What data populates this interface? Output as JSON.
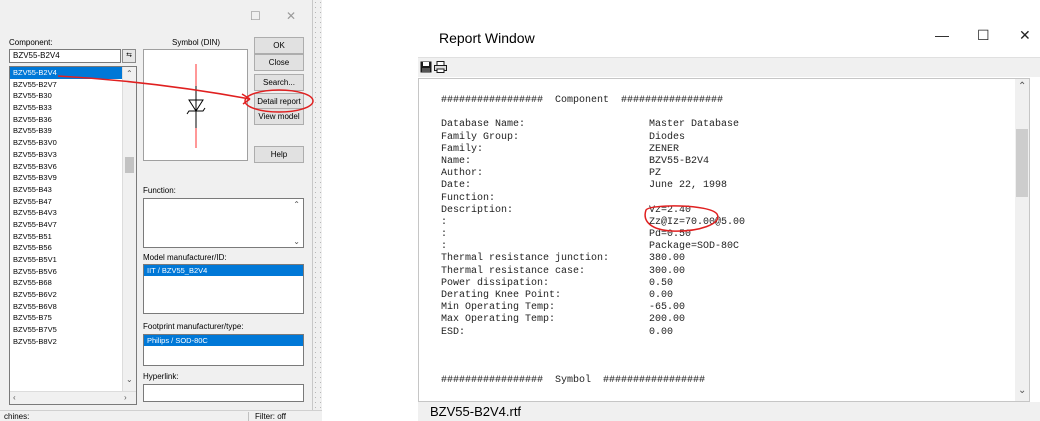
{
  "component_window": {
    "labels": {
      "component": "Component:",
      "symbol": "Symbol (DIN)",
      "function": "Function:",
      "model": "Model manufacturer/ID:",
      "footprint": "Footprint manufacturer/type:",
      "hyperlink": "Hyperlink:"
    },
    "search_value": "BZV55-B2V4",
    "filter_icon": "filter-icon",
    "components": [
      "BZV55-B2V4",
      "BZV55-B2V7",
      "BZV55-B30",
      "BZV55-B33",
      "BZV55-B36",
      "BZV55-B39",
      "BZV55-B3V0",
      "BZV55-B3V3",
      "BZV55-B3V6",
      "BZV55-B3V9",
      "BZV55-B43",
      "BZV55-B47",
      "BZV55-B4V3",
      "BZV55-B4V7",
      "BZV55-B51",
      "BZV55-B56",
      "BZV55-B5V1",
      "BZV55-B5V6",
      "BZV55-B68",
      "BZV55-B6V2",
      "BZV55-B6V8",
      "BZV55-B75",
      "BZV55-B7V5",
      "BZV55-B8V2"
    ],
    "selected_index": 0,
    "buttons": {
      "ok": "OK",
      "close": "Close",
      "search": "Search...",
      "detail_report": "Detail report",
      "view_model": "View model",
      "help": "Help"
    },
    "model_selected": "IIT / BZV55_B2V4",
    "footprint_selected": "Philips / SOD-80C",
    "status": {
      "left": "chines:",
      "right": "Filter: off"
    },
    "selection_color": "#0078d7",
    "annotation_color": "#e02020"
  },
  "report_window": {
    "title": "Report Window",
    "toolbar": {
      "save_icon": "save-icon",
      "print_icon": "print-icon"
    },
    "component_header": "#################  Component  #################",
    "fields": [
      {
        "key": "Database Name:",
        "value": "Master Database"
      },
      {
        "key": "Family Group:",
        "value": "Diodes"
      },
      {
        "key": "Family:",
        "value": "ZENER"
      },
      {
        "key": "Name:",
        "value": "BZV55-B2V4"
      },
      {
        "key": "Author:",
        "value": "PZ"
      },
      {
        "key": "Date:",
        "value": "June 22, 1998"
      },
      {
        "key": "Function:",
        "value": ""
      },
      {
        "key": "Description:",
        "value": "Vz=2.40"
      },
      {
        "key": ":",
        "value": "Zz@Iz=70.00@5.00"
      },
      {
        "key": ":",
        "value": "Pd=0.50"
      },
      {
        "key": ":",
        "value": "Package=SOD-80C"
      },
      {
        "key": "Thermal resistance junction:",
        "value": "380.00"
      },
      {
        "key": "Thermal resistance case:",
        "value": "300.00"
      },
      {
        "key": "Power dissipation:",
        "value": "0.50"
      },
      {
        "key": "Derating Knee Point:",
        "value": "0.00"
      },
      {
        "key": "Min Operating Temp:",
        "value": "-65.00"
      },
      {
        "key": "Max Operating Temp:",
        "value": "200.00"
      },
      {
        "key": "ESD:",
        "value": "0.00"
      }
    ],
    "symbol_header": "#################  Symbol  #################",
    "status_file": "BZV55-B2V4.rtf"
  }
}
